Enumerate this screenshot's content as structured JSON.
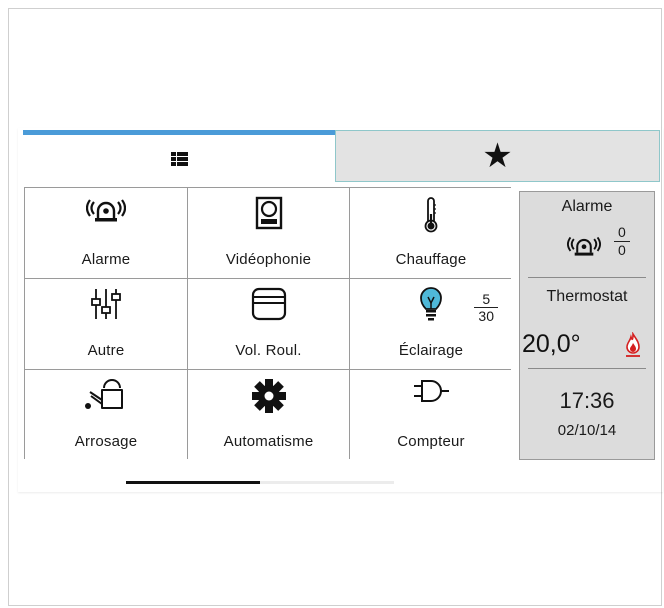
{
  "tabs": [
    {
      "name": "grid",
      "icon": "grid-icon",
      "active": true,
      "accent": "#4a9bd8"
    },
    {
      "name": "favorites",
      "icon": "star-icon",
      "symbol": "★",
      "active": false
    }
  ],
  "tiles": [
    {
      "label": "Alarme",
      "icon": "alarm-siren-icon"
    },
    {
      "label": "Vidéophonie",
      "icon": "videophone-icon"
    },
    {
      "label": "Chauffage",
      "icon": "thermometer-icon"
    },
    {
      "label": "Autre",
      "icon": "sliders-icon"
    },
    {
      "label": "Vol. Roul.",
      "icon": "roller-shutter-icon"
    },
    {
      "label": "Éclairage",
      "icon": "lightbulb-icon",
      "count_on": "5",
      "count_total": "30",
      "icon_color": "#4fb8d8"
    },
    {
      "label": "Arrosage",
      "icon": "watering-can-icon"
    },
    {
      "label": "Automatisme",
      "icon": "gear-icon"
    },
    {
      "label": "Compteur",
      "icon": "plug-icon"
    }
  ],
  "side": {
    "alarm_title": "Alarme",
    "alarm_icon": "alarm-siren-icon",
    "alarm_active": "0",
    "alarm_total": "0",
    "thermostat_title": "Thermostat",
    "temperature": "20,0°",
    "flame_icon": "flame-icon",
    "flame_color": "#d42020",
    "time": "17:36",
    "date": "02/10/14"
  },
  "pager": {
    "pages": 2,
    "current": 1
  }
}
